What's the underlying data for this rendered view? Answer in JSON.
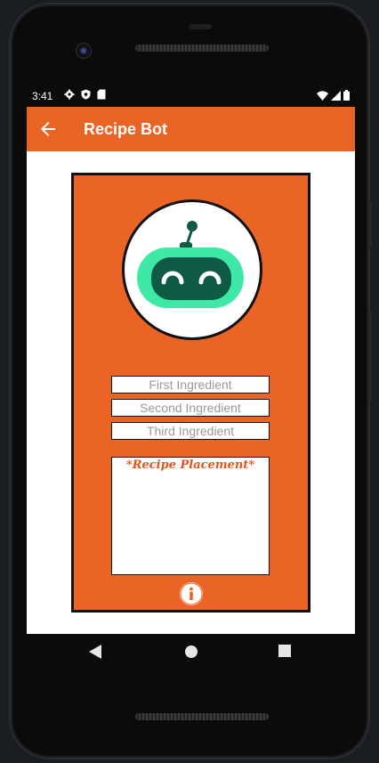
{
  "status_bar": {
    "time": "3:41",
    "left_icons": [
      "gear-icon",
      "shield-icon",
      "sd-card-icon"
    ],
    "right_icons": [
      "wifi-icon",
      "signal-icon",
      "battery-icon"
    ]
  },
  "app_bar": {
    "title": "Recipe Bot",
    "back_icon": "arrow-left-icon",
    "color": "#ea6426"
  },
  "main": {
    "card_color": "#ea6426",
    "bot_colors": {
      "face": "#3ee8a6",
      "visor": "#0f5a45"
    },
    "inputs": [
      {
        "placeholder": "First Ingredient",
        "value": ""
      },
      {
        "placeholder": "Second Ingredient",
        "value": ""
      },
      {
        "placeholder": "Third Ingredient",
        "value": ""
      }
    ],
    "recipe_placeholder": "*Recipe Placement*",
    "info_icon": "info-icon"
  },
  "nav_bar": {
    "buttons": [
      "back-triangle-icon",
      "home-circle-icon",
      "recents-square-icon"
    ]
  }
}
